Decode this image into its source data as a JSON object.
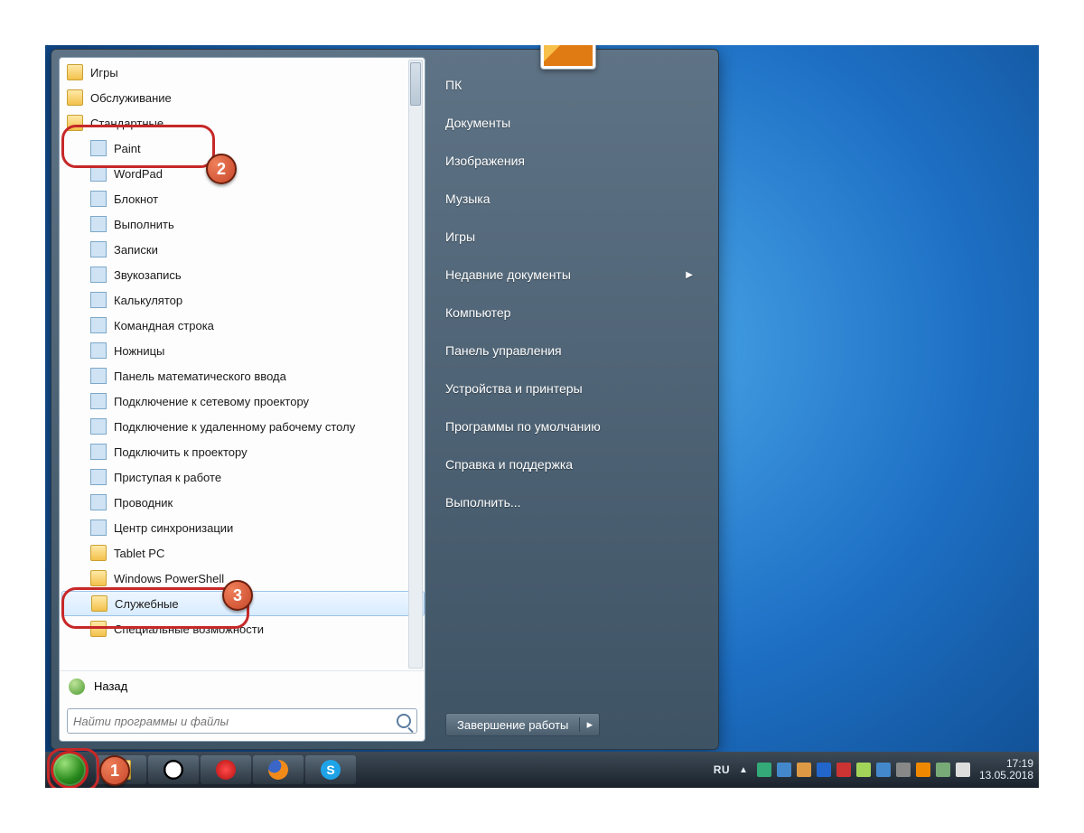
{
  "annotations": {
    "badge1": "1",
    "badge2": "2",
    "badge3": "3"
  },
  "start_menu": {
    "programs": [
      {
        "label": "Игры",
        "kind": "folder",
        "indent": 0
      },
      {
        "label": "Обслуживание",
        "kind": "folder",
        "indent": 0
      },
      {
        "label": "Стандартные",
        "kind": "folder",
        "indent": 0,
        "highlight": "callout2"
      },
      {
        "label": "Paint",
        "kind": "app",
        "indent": 1
      },
      {
        "label": "WordPad",
        "kind": "app",
        "indent": 1
      },
      {
        "label": "Блокнот",
        "kind": "app",
        "indent": 1
      },
      {
        "label": "Выполнить",
        "kind": "app",
        "indent": 1
      },
      {
        "label": "Записки",
        "kind": "app",
        "indent": 1
      },
      {
        "label": "Звукозапись",
        "kind": "app",
        "indent": 1
      },
      {
        "label": "Калькулятор",
        "kind": "app",
        "indent": 1
      },
      {
        "label": "Командная строка",
        "kind": "app",
        "indent": 1
      },
      {
        "label": "Ножницы",
        "kind": "app",
        "indent": 1
      },
      {
        "label": "Панель математического ввода",
        "kind": "app",
        "indent": 1
      },
      {
        "label": "Подключение к сетевому проектору",
        "kind": "app",
        "indent": 1
      },
      {
        "label": "Подключение к удаленному рабочему столу",
        "kind": "app",
        "indent": 1
      },
      {
        "label": "Подключить к проектору",
        "kind": "app",
        "indent": 1
      },
      {
        "label": "Приступая к работе",
        "kind": "app",
        "indent": 1
      },
      {
        "label": "Проводник",
        "kind": "app",
        "indent": 1
      },
      {
        "label": "Центр синхронизации",
        "kind": "app",
        "indent": 1
      },
      {
        "label": "Tablet PC",
        "kind": "folder",
        "indent": 1
      },
      {
        "label": "Windows PowerShell",
        "kind": "folder",
        "indent": 1
      },
      {
        "label": "Служебные",
        "kind": "folder",
        "indent": 1,
        "highlight": "callout3",
        "selected": true
      },
      {
        "label": "Специальные возможности",
        "kind": "folder",
        "indent": 1
      }
    ],
    "back_label": "Назад",
    "search_placeholder": "Найти программы и файлы",
    "right_items": [
      {
        "label": "ПК"
      },
      {
        "label": "Документы"
      },
      {
        "label": "Изображения"
      },
      {
        "label": "Музыка"
      },
      {
        "label": "Игры"
      },
      {
        "label": "Недавние документы",
        "submenu": true
      },
      {
        "label": "Компьютер"
      },
      {
        "label": "Панель управления"
      },
      {
        "label": "Устройства и принтеры"
      },
      {
        "label": "Программы по умолчанию"
      },
      {
        "label": "Справка и поддержка"
      },
      {
        "label": "Выполнить..."
      }
    ],
    "shutdown_label": "Завершение работы"
  },
  "taskbar": {
    "pinned": [
      "explorer",
      "panda",
      "opera",
      "firefox",
      "skype"
    ],
    "lang": "RU",
    "time": "17:19",
    "date": "13.05.2018"
  }
}
